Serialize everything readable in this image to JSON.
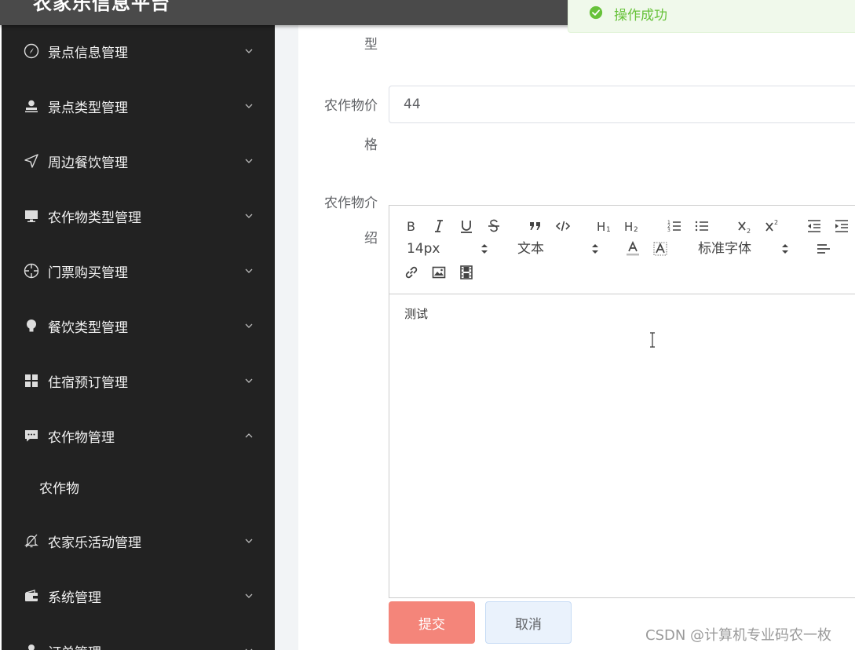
{
  "header": {
    "app_title": "农家乐信息平台"
  },
  "toast": {
    "icon": "check-circle-icon",
    "message": "操作成功",
    "color": "#67c23a"
  },
  "sidebar": {
    "items": [
      {
        "label": "景点信息管理",
        "icon": "compass-icon",
        "expanded": false
      },
      {
        "label": "景点类型管理",
        "icon": "user-stamp-icon",
        "expanded": false
      },
      {
        "label": "周边餐饮管理",
        "icon": "send-icon",
        "expanded": false
      },
      {
        "label": "农作物类型管理",
        "icon": "monitor-icon",
        "expanded": false
      },
      {
        "label": "门票购买管理",
        "icon": "target-icon",
        "expanded": false
      },
      {
        "label": "餐饮类型管理",
        "icon": "bulb-icon",
        "expanded": false
      },
      {
        "label": "住宿预订管理",
        "icon": "grid-icon",
        "expanded": false
      },
      {
        "label": "农作物管理",
        "icon": "chat-icon",
        "expanded": true,
        "children": [
          {
            "label": "农作物"
          }
        ]
      },
      {
        "label": "农家乐活动管理",
        "icon": "bell-off-icon",
        "expanded": false
      },
      {
        "label": "系统管理",
        "icon": "wallet-icon",
        "expanded": false
      },
      {
        "label": "订单管理",
        "icon": "user-icon",
        "expanded": false
      }
    ]
  },
  "form": {
    "type_label_tail": "型",
    "price_label_line1": "农作物价",
    "price_label_line2": "格",
    "price_value": "44",
    "intro_label_line1": "农作物介",
    "intro_label_line2": "绍",
    "editor": {
      "font_size": "14px",
      "header_select": "文本",
      "font_family": "标准字体",
      "content": "测试"
    },
    "submit_label": "提交",
    "cancel_label": "取消"
  },
  "watermark": "CSDN @计算机专业码农一枚"
}
